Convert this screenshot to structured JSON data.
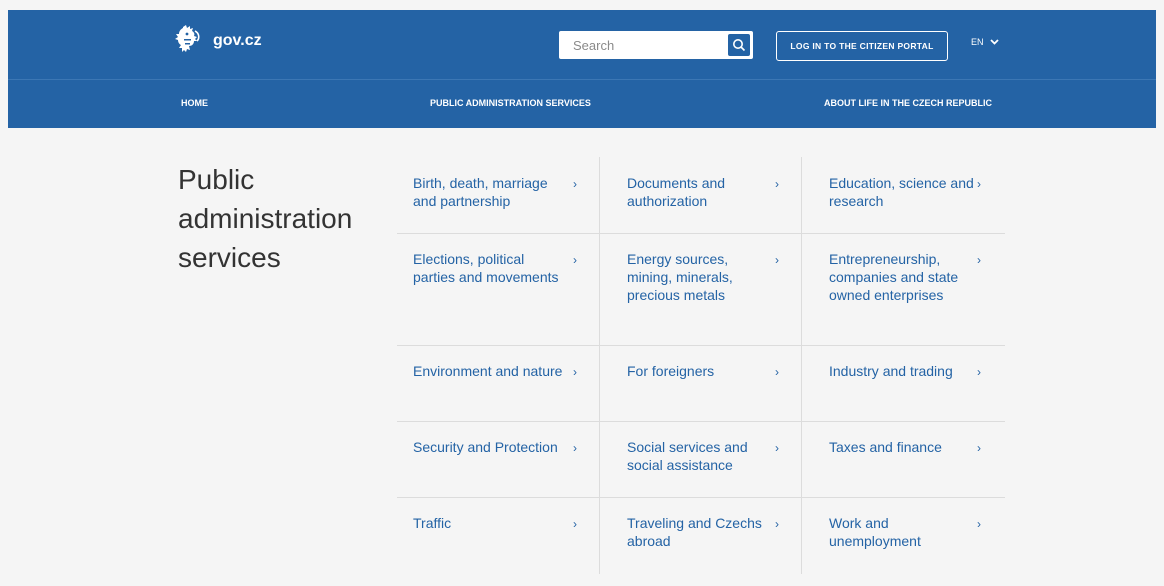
{
  "header": {
    "logo_text": "gov.cz",
    "search_placeholder": "Search",
    "login_label": "LOG IN TO THE CITIZEN PORTAL",
    "language": "EN"
  },
  "nav": {
    "home": "HOME",
    "public_admin": "PUBLIC ADMINISTRATION SERVICES",
    "about_life": "ABOUT LIFE IN THE CZECH REPUBLIC"
  },
  "page_title": "Public administration services",
  "categories": [
    "Birth, death, marriage and partnership",
    "Documents and authorization",
    "Education, science and research",
    "Elections, political parties and movements",
    "Energy sources, mining, minerals, precious metals",
    "Entrepreneurship, companies and state owned enterprises",
    "Environment and nature",
    "For foreigners",
    "Industry and trading",
    "Security and Protection",
    "Social services and social assistance",
    "Taxes and finance",
    "Traffic",
    "Traveling and Czechs abroad",
    "Work and unemployment"
  ],
  "chevron_glyph": "›"
}
